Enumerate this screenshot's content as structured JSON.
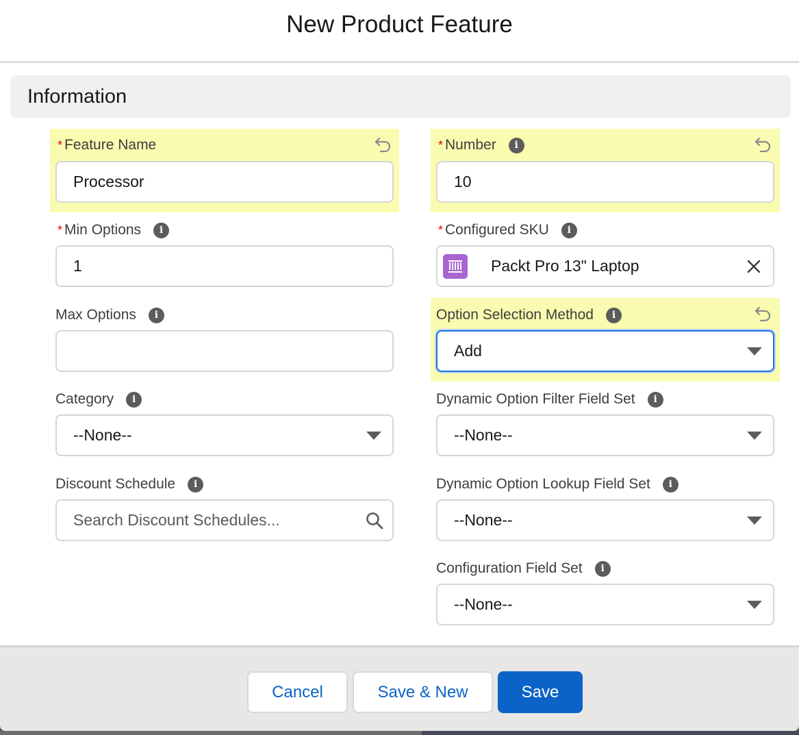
{
  "modal": {
    "title": "New Product Feature"
  },
  "section": {
    "title": "Information"
  },
  "fields": {
    "feature_name": {
      "label": "Feature Name",
      "required": true,
      "value": "Processor",
      "icon": "undo-icon"
    },
    "number": {
      "label": "Number",
      "required": true,
      "value": "10",
      "icon": "undo-icon"
    },
    "min_options": {
      "label": "Min Options",
      "required": true,
      "value": "1"
    },
    "configured_sku": {
      "label": "Configured SKU",
      "required": true,
      "value": "Packt Pro 13\" Laptop",
      "icon": "product-icon",
      "clear_icon": "close-icon"
    },
    "max_options": {
      "label": "Max Options",
      "value": ""
    },
    "option_selection_method": {
      "label": "Option Selection Method",
      "value": "Add",
      "icon": "undo-icon"
    },
    "category": {
      "label": "Category",
      "value": "--None--"
    },
    "dynamic_option_filter_field_set": {
      "label": "Dynamic Option Filter Field Set",
      "value": "--None--"
    },
    "discount_schedule": {
      "label": "Discount Schedule",
      "placeholder": "Search Discount Schedules...",
      "icon": "search-icon"
    },
    "dynamic_option_lookup_field_set": {
      "label": "Dynamic Option Lookup Field Set",
      "value": "--None--"
    },
    "configuration_field_set": {
      "label": "Configuration Field Set",
      "value": "--None--"
    }
  },
  "footer": {
    "cancel_label": "Cancel",
    "save_new_label": "Save & New",
    "save_label": "Save"
  },
  "colors": {
    "highlight": "#f9fbb0",
    "brand": "#0b63c7",
    "required": "#ee0000",
    "product_icon": "#a865d0"
  }
}
